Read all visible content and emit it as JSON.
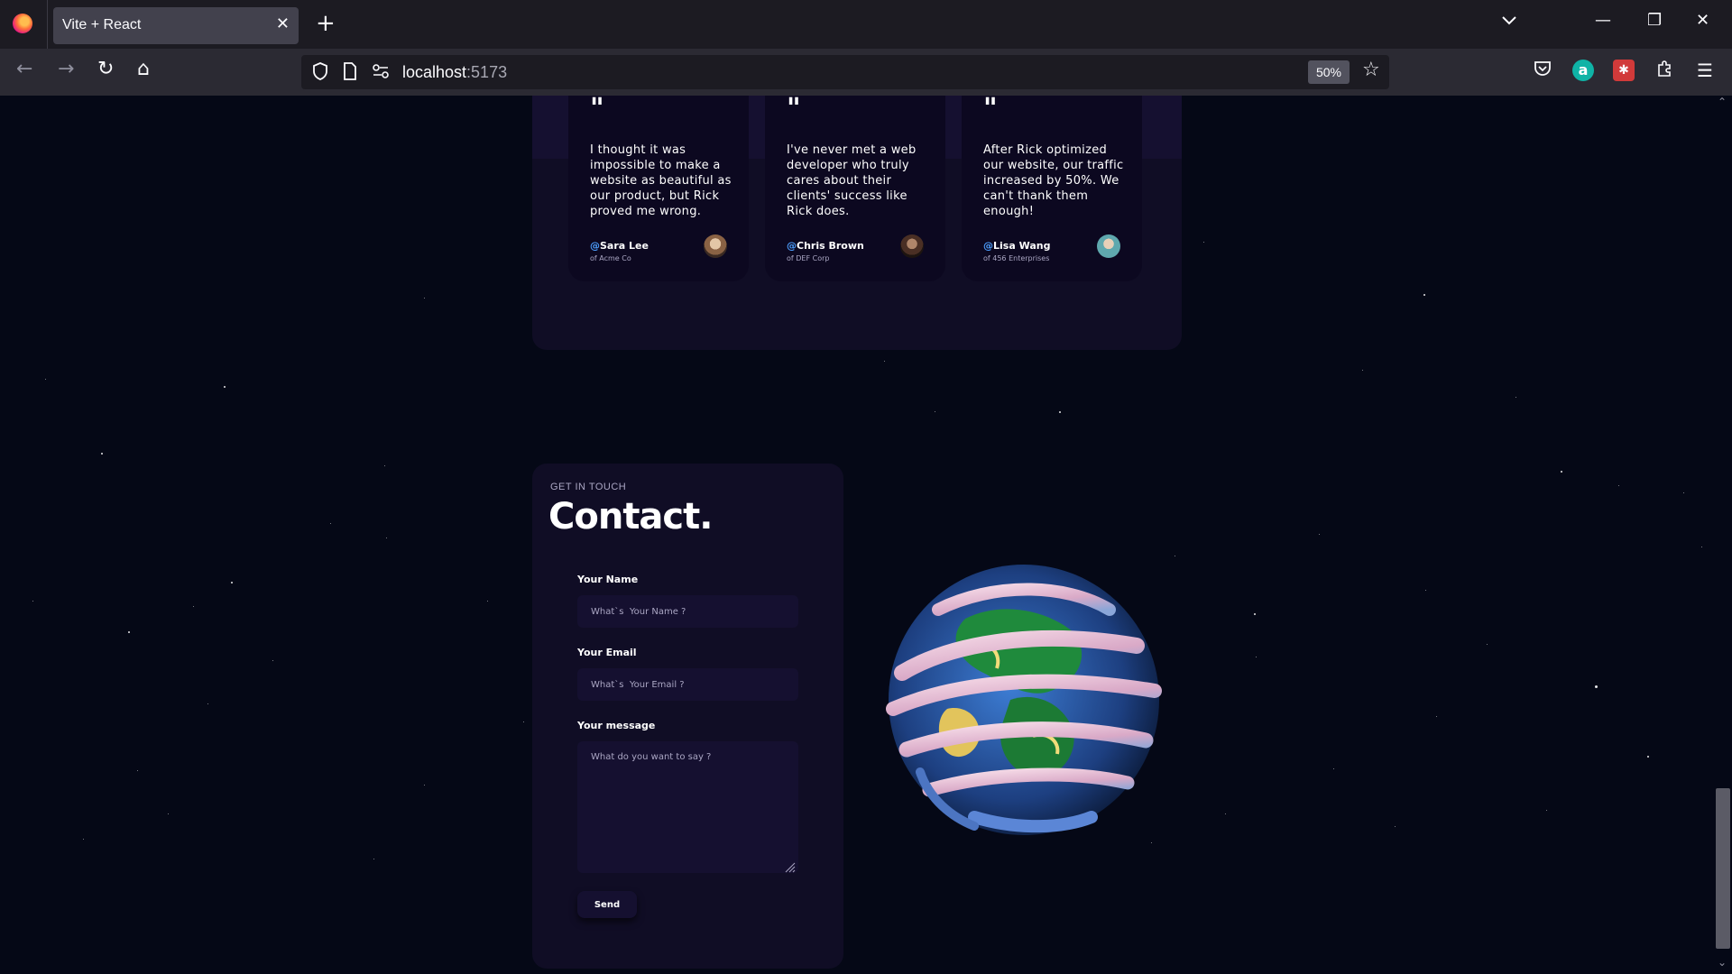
{
  "browser": {
    "tab_title": "Vite + React",
    "url_host": "localhost",
    "url_port": ":5173",
    "zoom": "50%"
  },
  "testimonials": [
    {
      "text": "I thought it was impossible to make a website as beautiful as our product, but Rick proved me wrong.",
      "name": "Sara Lee",
      "company": "of Acme Co",
      "avatar_color": "#c9a37a"
    },
    {
      "text": "I've never met a web developer who truly cares about their clients' success like Rick does.",
      "name": "Chris Brown",
      "company": "of DEF Corp",
      "avatar_color": "#6b4a3a"
    },
    {
      "text": "After Rick optimized our website, our traffic increased by 50%. We can't thank them enough!",
      "name": "Lisa Wang",
      "company": "of 456 Enterprises",
      "avatar_color": "#7fc3c9"
    }
  ],
  "contact": {
    "subtitle": "GET IN TOUCH",
    "title": "Contact.",
    "name_label": "Your Name",
    "name_placeholder": "What`s  Your Name ?",
    "email_label": "Your Email",
    "email_placeholder": "What`s  Your Email ?",
    "message_label": "Your message",
    "message_placeholder": "What do you want to say ?",
    "send_label": "Send"
  },
  "icons": {
    "back": "arrow-left-icon",
    "forward": "arrow-right-icon",
    "reload": "reload-icon",
    "home": "home-icon"
  }
}
